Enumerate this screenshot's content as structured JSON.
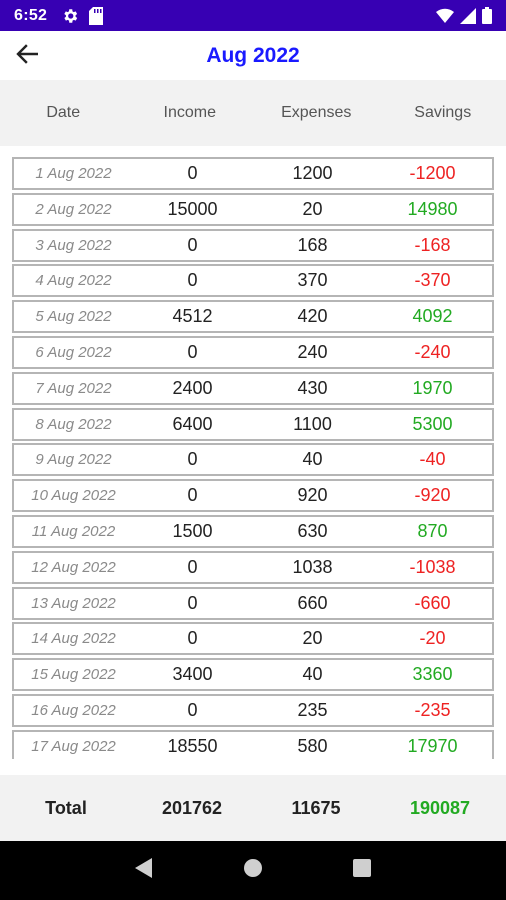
{
  "status_bar": {
    "time": "6:52",
    "icons": [
      "gear-icon",
      "sd-card-icon",
      "wifi-icon",
      "signal-icon",
      "battery-icon"
    ]
  },
  "app_bar": {
    "title": "Aug 2022",
    "back_icon": "arrow-left-icon"
  },
  "columns": {
    "date": "Date",
    "income": "Income",
    "expenses": "Expenses",
    "savings": "Savings"
  },
  "rows": [
    {
      "date": "1 Aug 2022",
      "income": "0",
      "expenses": "1200",
      "savings": "-1200",
      "positive": false
    },
    {
      "date": "2 Aug 2022",
      "income": "15000",
      "expenses": "20",
      "savings": "14980",
      "positive": true
    },
    {
      "date": "3 Aug 2022",
      "income": "0",
      "expenses": "168",
      "savings": "-168",
      "positive": false
    },
    {
      "date": "4 Aug 2022",
      "income": "0",
      "expenses": "370",
      "savings": "-370",
      "positive": false
    },
    {
      "date": "5 Aug 2022",
      "income": "4512",
      "expenses": "420",
      "savings": "4092",
      "positive": true
    },
    {
      "date": "6 Aug 2022",
      "income": "0",
      "expenses": "240",
      "savings": "-240",
      "positive": false
    },
    {
      "date": "7 Aug 2022",
      "income": "2400",
      "expenses": "430",
      "savings": "1970",
      "positive": true
    },
    {
      "date": "8 Aug 2022",
      "income": "6400",
      "expenses": "1100",
      "savings": "5300",
      "positive": true
    },
    {
      "date": "9 Aug 2022",
      "income": "0",
      "expenses": "40",
      "savings": "-40",
      "positive": false
    },
    {
      "date": "10 Aug 2022",
      "income": "0",
      "expenses": "920",
      "savings": "-920",
      "positive": false
    },
    {
      "date": "11 Aug 2022",
      "income": "1500",
      "expenses": "630",
      "savings": "870",
      "positive": true
    },
    {
      "date": "12 Aug 2022",
      "income": "0",
      "expenses": "1038",
      "savings": "-1038",
      "positive": false
    },
    {
      "date": "13 Aug 2022",
      "income": "0",
      "expenses": "660",
      "savings": "-660",
      "positive": false
    },
    {
      "date": "14 Aug 2022",
      "income": "0",
      "expenses": "20",
      "savings": "-20",
      "positive": false
    },
    {
      "date": "15 Aug 2022",
      "income": "3400",
      "expenses": "40",
      "savings": "3360",
      "positive": true
    },
    {
      "date": "16 Aug 2022",
      "income": "0",
      "expenses": "235",
      "savings": "-235",
      "positive": false
    },
    {
      "date": "17 Aug 2022",
      "income": "18550",
      "expenses": "580",
      "savings": "17970",
      "positive": true
    }
  ],
  "totals": {
    "label": "Total",
    "income": "201762",
    "expenses": "11675",
    "savings": "190087"
  },
  "colors": {
    "positive": "#22aa22",
    "negative": "#ee2222",
    "title": "#1a1aff",
    "status_bar": "#3700b3"
  },
  "nav_bar": {
    "icons": [
      "back-triangle-icon",
      "home-circle-icon",
      "recents-square-icon"
    ]
  }
}
